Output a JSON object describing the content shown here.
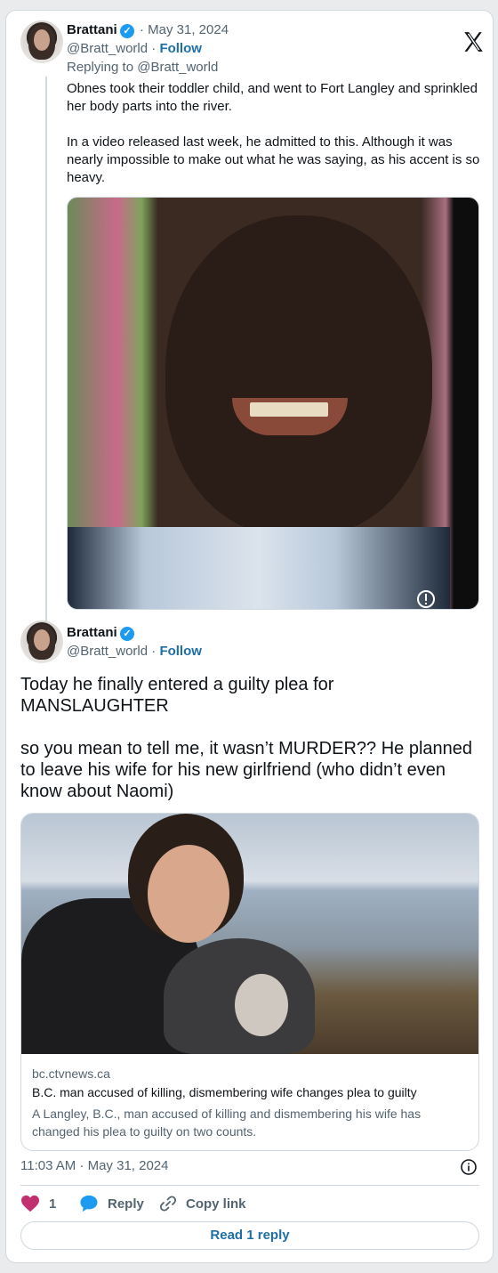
{
  "tweet1": {
    "author": "Brattani",
    "date": "· May 31, 2024",
    "handle": "@Bratt_world",
    "follow": "Follow",
    "separator": " · ",
    "replying_to": "Replying to @Bratt_world",
    "text": "Obnes took their toddler child, and went to Fort Langley and sprinkled her body parts into the river.\n\nIn a video released last week, he admitted to this. Although it was nearly impossible to make out what he was saying, as his accent is so heavy."
  },
  "tweet2": {
    "author": "Brattani",
    "handle": "@Bratt_world",
    "follow": "Follow",
    "separator": " · ",
    "text": "Today he finally entered a guilty plea for MANSLAUGHTER\n\nso you mean to tell me, it wasn’t MURDER?? He planned to leave his wife for his new girlfriend (who didn’t even know about Naomi)"
  },
  "link_card": {
    "domain": "bc.ctvnews.ca",
    "title": "B.C. man accused of killing, dismembering wife changes plea to guilty",
    "description": "A Langley, B.C., man accused of killing and dismembering his wife has changed his plea to guilty on two counts."
  },
  "footer": {
    "timestamp": "11:03 AM · May 31, 2024",
    "like_count": "1",
    "reply_label": "Reply",
    "copy_link_label": "Copy link",
    "read_replies_label": "Read 1 reply"
  },
  "colors": {
    "verified": "#1d9bf0",
    "link": "#1d6fa5",
    "like": "#f91880"
  }
}
